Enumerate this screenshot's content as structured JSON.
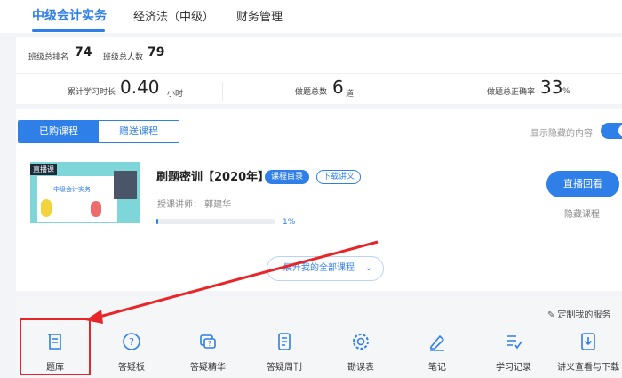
{
  "tabs": [
    {
      "label": "中级会计实务",
      "active": true
    },
    {
      "label": "经济法（中级）",
      "active": false
    },
    {
      "label": "财务管理",
      "active": false
    }
  ],
  "rank": {
    "class_rank_label": "班级总排名",
    "class_rank_value": "74",
    "class_total_label": "班级总人数",
    "class_total_value": "79"
  },
  "stats": {
    "study_time_label": "累计学习时长",
    "study_time_value": "0.40",
    "study_time_unit": "小时",
    "questions_label": "做题总数",
    "questions_value": "6",
    "questions_unit": "道",
    "accuracy_label": "做题总正确率",
    "accuracy_value": "33",
    "accuracy_unit": "%"
  },
  "course_tabs": {
    "purchased": "已购课程",
    "gifted": "赠送课程"
  },
  "show_hidden_label": "显示隐藏的内容",
  "course": {
    "thumb_badge": "直播课",
    "thumb_title": "中级会计实务",
    "title": "刷题密训【2020年】",
    "catalog_tag": "课程目录",
    "download_tag": "下载讲义",
    "teacher": "授课讲师： 郭建华",
    "progress_percent_label": "1%",
    "progress_fraction": 0.01,
    "replay_button": "直播回看",
    "hide_course": "隐藏课程"
  },
  "expand_all": "展开我的全部课程",
  "customize_service": "定制我的服务",
  "services": [
    {
      "label": "题库",
      "icon": "question-bank-icon"
    },
    {
      "label": "答疑板",
      "icon": "qa-board-icon"
    },
    {
      "label": "答疑精华",
      "icon": "qa-highlights-icon"
    },
    {
      "label": "答疑周刊",
      "icon": "qa-weekly-icon"
    },
    {
      "label": "勘误表",
      "icon": "errata-gear-icon"
    },
    {
      "label": "笔记",
      "icon": "notes-pen-icon"
    },
    {
      "label": "学习记录",
      "icon": "study-record-icon"
    },
    {
      "label": "讲义查看与下载",
      "icon": "handout-download-icon"
    }
  ],
  "colors": {
    "accent": "#2f7fe8",
    "highlight": "#e8262a"
  }
}
